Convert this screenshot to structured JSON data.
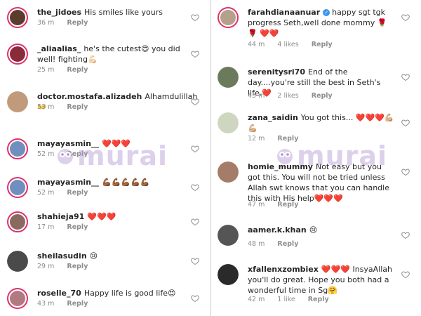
{
  "left_comments": [
    {
      "username": "the_jidoes",
      "text": "His smiles like yours",
      "time": "36 m",
      "likes": "",
      "reply": "Reply",
      "avatar_color": "#5b3d2e"
    },
    {
      "username": "_aliaalias_",
      "text": "he's the cutest😍 you did well! fighting💪🏻",
      "time": "25 m",
      "likes": "",
      "reply": "Reply",
      "avatar_color": "#8b2b3a"
    },
    {
      "username": "doctor.mostafa.alizadeh",
      "text": "Alhamdulillah 👐",
      "time": "53 m",
      "likes": "",
      "reply": "Reply",
      "avatar_color": "#c09a7a"
    },
    {
      "username": "mayayasmin__",
      "text": "❤️❤️❤️",
      "time": "52 m",
      "likes": "",
      "reply": "Reply",
      "avatar_color": "#6f8fbf"
    },
    {
      "username": "mayayasmin__",
      "text": "💪🏾💪🏾💪🏾💪🏾💪🏾",
      "time": "52 m",
      "likes": "",
      "reply": "Reply",
      "avatar_color": "#6f8fbf"
    },
    {
      "username": "shahieja91",
      "text": "❤️❤️❤️",
      "time": "17 m",
      "likes": "",
      "reply": "Reply",
      "avatar_color": "#8a6a5e"
    },
    {
      "username": "sheilasudin",
      "text": "😢",
      "time": "29 m",
      "likes": "",
      "reply": "Reply",
      "avatar_color": "#4a4a4a"
    },
    {
      "username": "roselle_70",
      "text": "Happy life is good life😍",
      "time": "43 m",
      "likes": "",
      "reply": "Reply",
      "avatar_color": "#b07a80"
    }
  ],
  "right_comments": [
    {
      "username": "farahdianaanuar",
      "text": "happy sgt tgk progress Seth,well done mommy 🌹🌹 ❤️❤️",
      "time": "44 m",
      "likes": "4 likes",
      "reply": "Reply",
      "avatar_color": "#b5a08a",
      "verified": true
    },
    {
      "username": "serenitysri70",
      "text": "End of the day....you're still the best in Seth's life.❤️",
      "time": "45 m",
      "likes": "2 likes",
      "reply": "Reply",
      "avatar_color": "#6a7a5a"
    },
    {
      "username": "zana_saidin",
      "text": "You got this... ❤️❤️❤️💪🏼 💪🏼",
      "time": "12 m",
      "likes": "",
      "reply": "Reply",
      "avatar_color": "#cfd6c0"
    },
    {
      "username": "homie_mummy",
      "text": "Not easy but you got this. You will not be tried unless Allah swt knows that you can handle this with His help❤️❤️❤️",
      "time": "47 m",
      "likes": "",
      "reply": "Reply",
      "avatar_color": "#a47c68"
    },
    {
      "username": "aamer.k.khan",
      "text": "😢",
      "time": "48 m",
      "likes": "",
      "reply": "Reply",
      "avatar_color": "#555555"
    },
    {
      "username": "xfallenxzombiex",
      "text": "❤️❤️❤️ InsyaAllah you'll do great. Hope you both had a wonderful time in Sg🤗",
      "time": "42 m",
      "likes": "1 like",
      "reply": "Reply",
      "avatar_color": "#2a2a2a"
    }
  ],
  "watermark": {
    "text": "murai",
    "color": "#b497d2"
  },
  "icons": {
    "like": "heart-outline-icon",
    "verified": "verified-badge-icon"
  }
}
